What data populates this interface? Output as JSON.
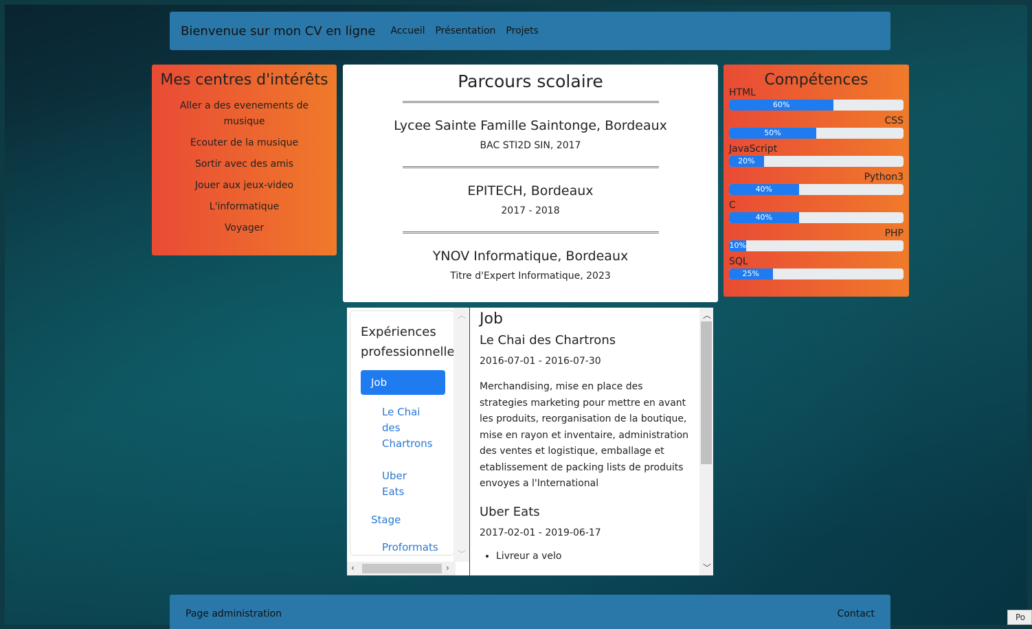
{
  "nav": {
    "brand": "Bienvenue sur mon CV en ligne",
    "links": [
      "Accueil",
      "Présentation",
      "Projets"
    ]
  },
  "interests": {
    "title": "Mes centres d'intérêts",
    "items": [
      "Aller a des evenements de musique",
      "Ecouter de la musique",
      "Sortir avec des amis",
      "Jouer aux jeux-video",
      "L'informatique",
      "Voyager"
    ]
  },
  "education": {
    "title": "Parcours scolaire",
    "entries": [
      {
        "school": "Lycee Sainte Famille Saintonge, Bordeaux",
        "detail": "BAC STI2D SIN, 2017"
      },
      {
        "school": "EPITECH, Bordeaux",
        "detail": "2017 - 2018"
      },
      {
        "school": "YNOV Informatique, Bordeaux",
        "detail": "Titre d'Expert Informatique, 2023"
      }
    ]
  },
  "skills": {
    "title": "Compétences",
    "items": [
      {
        "name": "HTML",
        "percent": 60,
        "label": "60%",
        "align": "left"
      },
      {
        "name": "CSS",
        "percent": 50,
        "label": "50%",
        "align": "right"
      },
      {
        "name": "JavaScript",
        "percent": 20,
        "label": "20%",
        "align": "left"
      },
      {
        "name": "Python3",
        "percent": 40,
        "label": "40%",
        "align": "right"
      },
      {
        "name": "C",
        "percent": 40,
        "label": "40%",
        "align": "left"
      },
      {
        "name": "PHP",
        "percent": 10,
        "label": "10%",
        "align": "right"
      },
      {
        "name": "SQL",
        "percent": 25,
        "label": "25%",
        "align": "left"
      }
    ]
  },
  "experience_nav": {
    "title": "Expériences professionnelles",
    "active": "Job",
    "job_links": [
      "Le Chai des Chartrons",
      "Uber Eats"
    ],
    "stage": "Stage",
    "stage_links": [
      "Proformats"
    ]
  },
  "job_detail": {
    "title": "Job",
    "company1": "Le Chai des Chartrons",
    "dates1": "2016-07-01 - 2016-07-30",
    "description1": "Merchandising, mise en place des strategies marketing pour mettre en avant les produits, reorganisation de la boutique, mise en rayon et inventaire, administration des ventes et logistique, emballage et etablissement de packing lists de produits envoyes a l'International",
    "company2": "Uber Eats",
    "dates2": "2017-02-01 - 2019-06-17",
    "bullet1": "Livreur a velo"
  },
  "footer": {
    "admin": "Page administration",
    "contact": "Contact"
  },
  "corner_text": "Po",
  "colors": {
    "navbar": "#2a78aa",
    "orange_start": "#e94b35",
    "orange_end": "#f07a2a",
    "progress": "#1e7bf0",
    "link": "#2a78d0"
  }
}
